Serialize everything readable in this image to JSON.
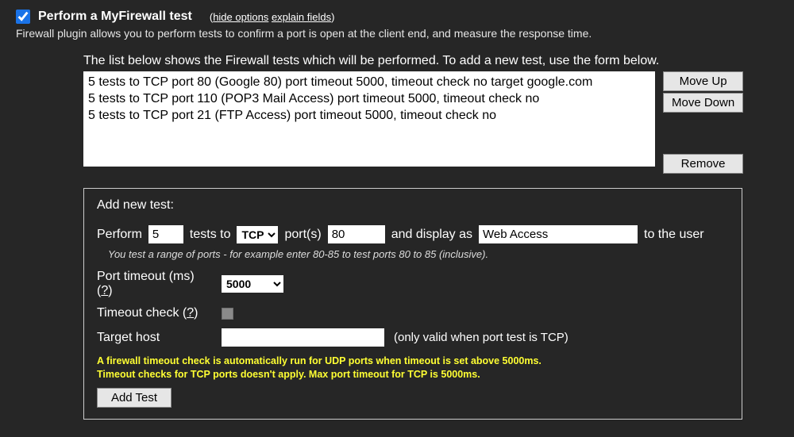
{
  "header": {
    "checkbox_checked": true,
    "title": "Perform a MyFirewall test",
    "hide_options": "hide options",
    "explain_fields": "explain fields",
    "description": "Firewall plugin allows you to perform tests to confirm a port is open at the client end, and measure the response time."
  },
  "list": {
    "label": "The list below shows the Firewall tests which will be performed. To add a new test, use the form below.",
    "items": [
      "5 tests to TCP port 80 (Google 80) port timeout 5000, timeout check no target google.com",
      "5 tests to TCP port 110 (POP3 Mail Access) port timeout 5000, timeout check no",
      "5 tests to TCP port 21 (FTP Access) port timeout 5000, timeout check no"
    ],
    "move_up": "Move Up",
    "move_down": "Move Down",
    "remove": "Remove"
  },
  "form": {
    "legend": "Add new test:",
    "perform": "Perform",
    "count_value": "5",
    "tests_to": "tests to",
    "protocol_selected": "TCP",
    "ports_label": "port(s)",
    "port_value": "80",
    "display_as": "and display as",
    "display_value": "Web Access",
    "to_user": "to the user",
    "hint": "You test a range of ports - for example enter 80-85 to test ports 80 to 85 (inclusive).",
    "port_timeout_label": "Port timeout (ms) (",
    "help_q": "?",
    "port_timeout_close": ")",
    "timeout_value": "5000",
    "timeout_check_label": "Timeout check (",
    "target_host_label": "Target host",
    "target_host_value": "",
    "target_host_suffix": "(only valid when port test is TCP)",
    "warning_line1": "A firewall timeout check is ",
    "warning_auto": "automatically",
    "warning_line1b": " run for UDP ports when timeout is set above 5000ms.",
    "warning_line2": "Timeout checks for TCP ports doesn't apply. Max port timeout for TCP is 5000ms.",
    "add_test": "Add Test"
  }
}
